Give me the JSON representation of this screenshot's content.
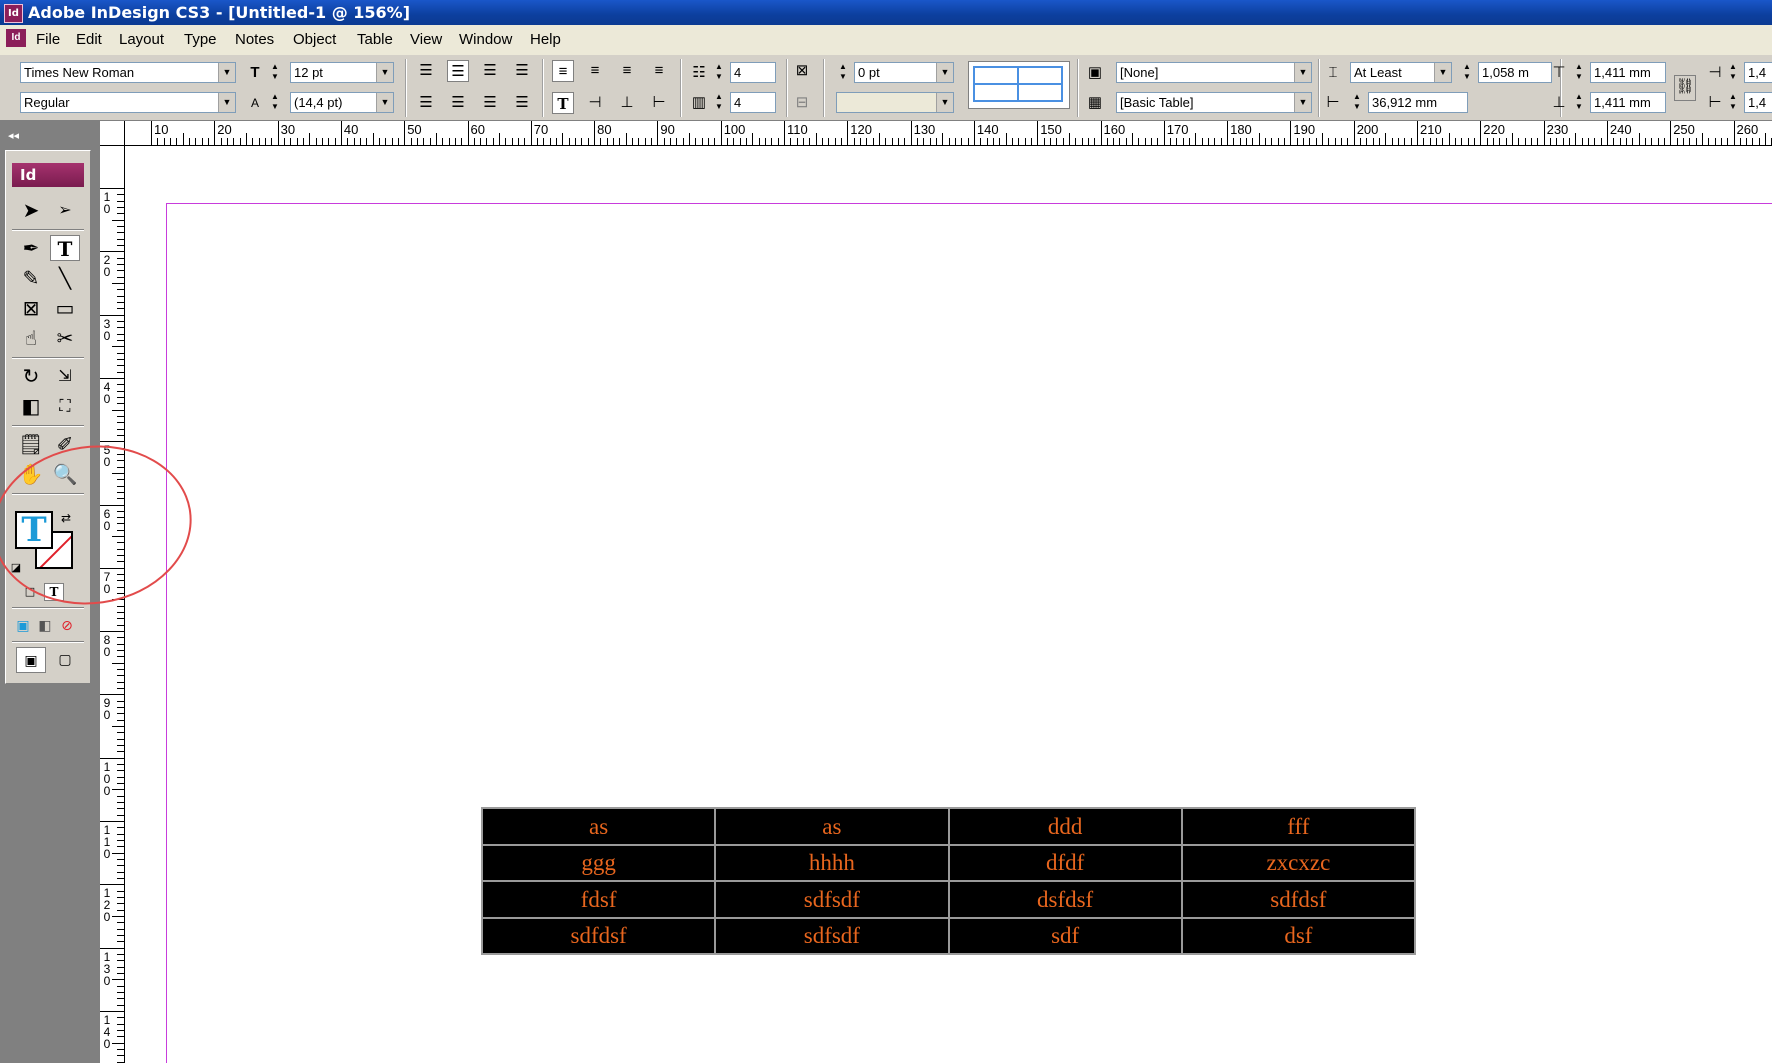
{
  "window": {
    "title": "Adobe InDesign CS3 - [Untitled-1 @ 156%]",
    "app_icon": "Id"
  },
  "menu": [
    "File",
    "Edit",
    "Layout",
    "Type",
    "Notes",
    "Object",
    "Table",
    "View",
    "Window",
    "Help"
  ],
  "control_panel": {
    "font_family": "Times New Roman",
    "font_style": "Regular",
    "font_size": "12 pt",
    "leading": "(14,4 pt)",
    "rows": "4",
    "columns": "4",
    "stroke_weight": "0 pt",
    "cell_style": "[None]",
    "table_style": "[Basic Table]",
    "row_height_mode": "At Least",
    "row_height": "1,058 m",
    "column_width": "36,912 mm",
    "inset_top": "1,411 mm",
    "inset_bottom": "1,411 mm",
    "inset_right_top": "1,4",
    "inset_right_bottom": "1,4"
  },
  "ruler_top_labels": [
    "10",
    "20",
    "30",
    "40",
    "50",
    "60",
    "70",
    "80",
    "90",
    "100",
    "110",
    "120",
    "130",
    "140",
    "150",
    "160",
    "170",
    "180",
    "190",
    "200",
    "210",
    "220",
    "230",
    "240",
    "250",
    "260"
  ],
  "ruler_left_labels": [
    "10",
    "20",
    "30",
    "40",
    "50",
    "60",
    "70",
    "80",
    "90",
    "100",
    "110",
    "120",
    "130",
    "140"
  ],
  "toolbox": {
    "logo": "Id",
    "collapse": "◂◂"
  },
  "table": [
    [
      "as",
      "as",
      "ddd",
      "fff"
    ],
    [
      "ggg",
      "hhhh",
      "dfdf",
      "zxcxzc"
    ],
    [
      "fdsf",
      "sdfsdf",
      "dsfdsf",
      "sdfdsf"
    ],
    [
      "sdfdsf",
      "sdfsdf",
      "sdf",
      "dsf"
    ]
  ],
  "colors": {
    "title_bar": "#0c3f9e",
    "accent_app": "#8c1f5a",
    "table_text": "#e8661e",
    "margin_guide": "#c83cdc",
    "annotation": "#e24b4b"
  }
}
